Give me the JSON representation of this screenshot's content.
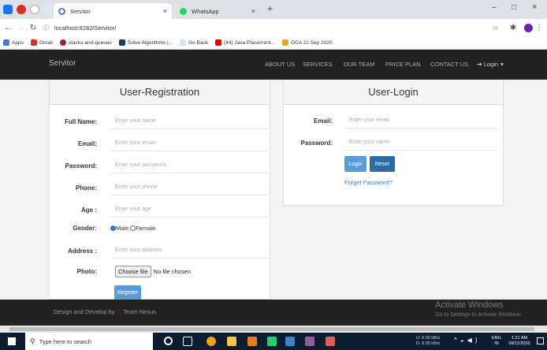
{
  "browser": {
    "tabs": [
      {
        "label": "Servitor",
        "close": "×"
      },
      {
        "label": "WhatsApp",
        "close": "×"
      }
    ],
    "new_tab": "+",
    "url": "localhost:8282/Servitor/",
    "bookmarks": [
      "Apps",
      "Gmail",
      "stacks-and-queues",
      "Solve Algorithms |...",
      "Go Back",
      "(44) Java Placement...",
      "OCA 21 Sep 2020"
    ],
    "window_controls": [
      "–",
      "□",
      "×"
    ]
  },
  "navbar": {
    "brand": "Servitor",
    "links": [
      "ABOUT US",
      "SERVICES",
      "OUR TEAM",
      "PRICE PLAN",
      "CONTACT US"
    ],
    "login": "Login",
    "login_caret": "▾"
  },
  "registration": {
    "title": "User-Registration",
    "fields": [
      {
        "label": "Full Name:",
        "placeholder": "Enter your name"
      },
      {
        "label": "Email:",
        "placeholder": "Enter your email"
      },
      {
        "label": "Password:",
        "placeholder": "Enter your password"
      },
      {
        "label": "Phone:",
        "placeholder": "Enter your phone"
      },
      {
        "label": "Age :",
        "placeholder": "Enter your age"
      }
    ],
    "gender_label": "Gender:",
    "gender_options": [
      "Male",
      "Female"
    ],
    "address_label": "Address :",
    "address_placeholder": "Enter your address",
    "photo_label": "Photo:",
    "choose_file": "Choose file",
    "no_file": "No file chosen",
    "register": "Register"
  },
  "login": {
    "title": "User-Login",
    "email_label": "Email:",
    "email_placeholder": "Enter your email",
    "password_label": "Password:",
    "password_placeholder": "Enter your name",
    "login_btn": "Login",
    "reset_btn": "Reset",
    "forget": "Forget Password?"
  },
  "footer": {
    "prefix": "Design and Develop by",
    "heart": "♡",
    "suffix": "Team Nexus"
  },
  "watermark": {
    "title": "Activate Windows",
    "subtitle": "Go to Settings to activate Windows."
  },
  "taskbar": {
    "search": "Type here to search",
    "net_up": "0.00 kB/s",
    "net_down": "0.00 kB/s",
    "net_up_label": "U:",
    "net_down_label": "D:",
    "lang": "ENG",
    "lang2": "IN",
    "time": "1:21 AM",
    "date": "09/11/2020"
  },
  "colors": {
    "navbar": "#222222",
    "primary_button": "#337ab7",
    "link": "#337ab7",
    "heart": "#e32b2b"
  }
}
